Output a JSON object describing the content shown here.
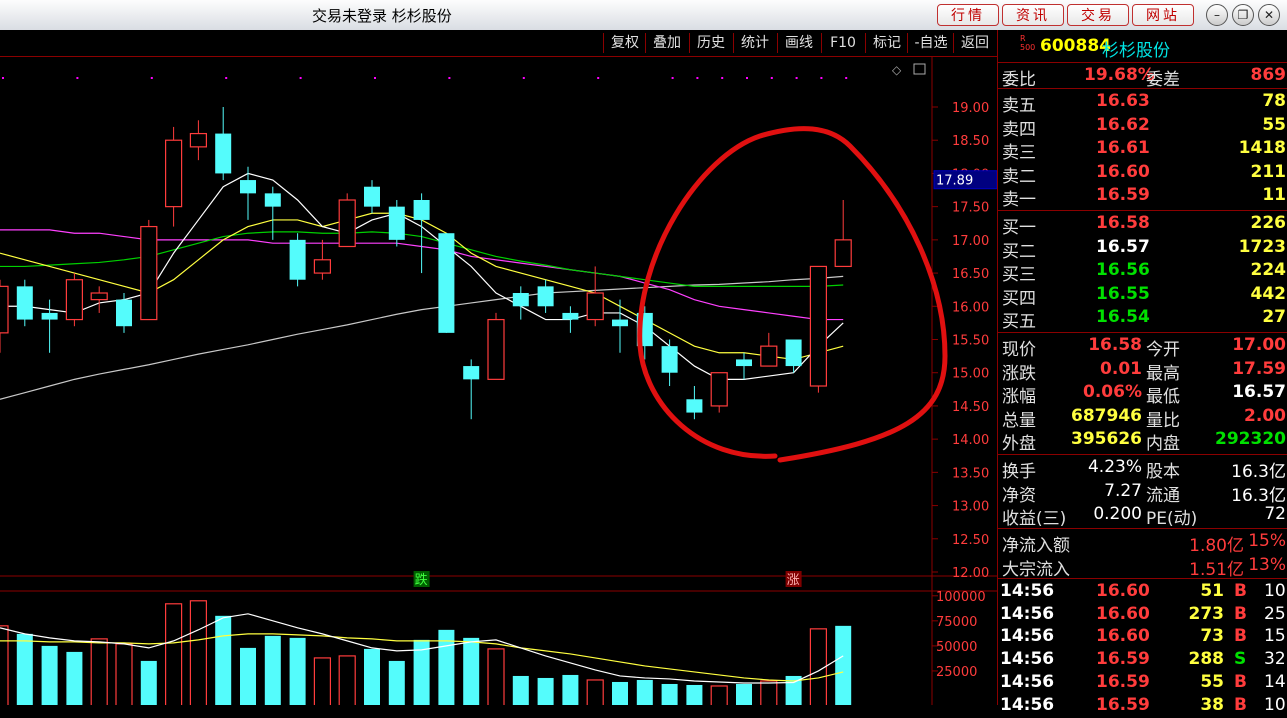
{
  "titlebar": {
    "title": "交易未登录  杉杉股份",
    "nav_buttons": [
      "行情",
      "资讯",
      "交易",
      "网站"
    ],
    "window_buttons": [
      "minimize",
      "restore",
      "close"
    ]
  },
  "toolbar": {
    "items": [
      "复权",
      "叠加",
      "历史",
      "统计",
      "画线",
      "F10",
      "标记",
      "-自选",
      "返回"
    ]
  },
  "chart_price": {
    "y_ticks": [
      "19.00",
      "18.50",
      "18.00",
      "17.50",
      "17.00",
      "16.50",
      "16.00",
      "15.50",
      "15.00",
      "14.50",
      "14.00",
      "13.50",
      "13.00",
      "12.50",
      "12.00"
    ],
    "ylim": [
      12.0,
      19.0
    ],
    "current_marker": "17.89",
    "markers": [
      {
        "text": "跌",
        "idx": 17
      },
      {
        "text": "涨",
        "idx": 32
      }
    ],
    "candles": [
      {
        "o": 15.6,
        "c": 16.3,
        "h": 16.4,
        "l": 15.3
      },
      {
        "o": 16.3,
        "c": 15.8,
        "h": 16.4,
        "l": 15.7
      },
      {
        "o": 15.9,
        "c": 15.8,
        "h": 16.1,
        "l": 15.3
      },
      {
        "o": 15.8,
        "c": 16.4,
        "h": 16.5,
        "l": 15.7
      },
      {
        "o": 16.1,
        "c": 16.2,
        "h": 16.3,
        "l": 15.9
      },
      {
        "o": 16.1,
        "c": 15.7,
        "h": 16.2,
        "l": 15.6
      },
      {
        "o": 15.8,
        "c": 17.2,
        "h": 17.3,
        "l": 15.8
      },
      {
        "o": 17.5,
        "c": 18.5,
        "h": 18.7,
        "l": 17.2
      },
      {
        "o": 18.4,
        "c": 18.6,
        "h": 18.8,
        "l": 18.2
      },
      {
        "o": 18.6,
        "c": 18.0,
        "h": 19.0,
        "l": 17.9
      },
      {
        "o": 17.9,
        "c": 17.7,
        "h": 18.1,
        "l": 17.3
      },
      {
        "o": 17.7,
        "c": 17.5,
        "h": 17.8,
        "l": 17.0
      },
      {
        "o": 17.0,
        "c": 16.4,
        "h": 17.1,
        "l": 16.3
      },
      {
        "o": 16.5,
        "c": 16.7,
        "h": 17.0,
        "l": 16.4
      },
      {
        "o": 16.9,
        "c": 17.6,
        "h": 17.7,
        "l": 16.9
      },
      {
        "o": 17.8,
        "c": 17.5,
        "h": 17.9,
        "l": 17.4
      },
      {
        "o": 17.5,
        "c": 17.0,
        "h": 17.6,
        "l": 16.9
      },
      {
        "o": 17.6,
        "c": 17.3,
        "h": 17.7,
        "l": 16.5
      },
      {
        "o": 17.1,
        "c": 15.6,
        "h": 17.1,
        "l": 15.6
      },
      {
        "o": 15.1,
        "c": 14.9,
        "h": 15.2,
        "l": 14.3
      },
      {
        "o": 14.9,
        "c": 15.8,
        "h": 15.9,
        "l": 14.9
      },
      {
        "o": 16.2,
        "c": 16.0,
        "h": 16.3,
        "l": 15.8
      },
      {
        "o": 16.3,
        "c": 16.0,
        "h": 16.4,
        "l": 15.9
      },
      {
        "o": 15.9,
        "c": 15.8,
        "h": 16.0,
        "l": 15.6
      },
      {
        "o": 15.8,
        "c": 16.2,
        "h": 16.6,
        "l": 15.7
      },
      {
        "o": 15.8,
        "c": 15.7,
        "h": 16.1,
        "l": 15.3
      },
      {
        "o": 15.9,
        "c": 15.4,
        "h": 16.0,
        "l": 15.2
      },
      {
        "o": 15.4,
        "c": 15.0,
        "h": 15.5,
        "l": 14.8
      },
      {
        "o": 14.6,
        "c": 14.4,
        "h": 14.8,
        "l": 14.3
      },
      {
        "o": 14.5,
        "c": 15.0,
        "h": 15.0,
        "l": 14.4
      },
      {
        "o": 15.2,
        "c": 15.1,
        "h": 15.3,
        "l": 14.9
      },
      {
        "o": 15.1,
        "c": 15.4,
        "h": 15.6,
        "l": 15.1
      },
      {
        "o": 15.5,
        "c": 15.1,
        "h": 15.5,
        "l": 15.0
      },
      {
        "o": 14.8,
        "c": 16.6,
        "h": 16.6,
        "l": 14.7
      },
      {
        "o": 16.6,
        "c": 17.0,
        "h": 17.6,
        "l": 16.6
      }
    ],
    "ma_white": [
      16.0,
      16.0,
      15.95,
      15.9,
      16.05,
      16.1,
      16.2,
      16.8,
      17.3,
      17.8,
      18.0,
      17.9,
      17.6,
      17.2,
      17.1,
      17.3,
      17.4,
      17.2,
      16.9,
      16.6,
      16.2,
      16.0,
      15.8,
      15.8,
      15.9,
      15.9,
      15.7,
      15.4,
      15.1,
      14.9,
      14.9,
      14.95,
      15.0,
      15.4,
      15.75
    ],
    "ma_yellow": [
      16.8,
      16.7,
      16.6,
      16.5,
      16.4,
      16.3,
      16.2,
      16.4,
      16.7,
      17.0,
      17.2,
      17.3,
      17.3,
      17.2,
      17.3,
      17.4,
      17.4,
      17.3,
      17.1,
      16.8,
      16.6,
      16.5,
      16.4,
      16.3,
      16.2,
      16.0,
      15.8,
      15.6,
      15.4,
      15.3,
      15.3,
      15.25,
      15.2,
      15.3,
      15.4
    ],
    "ma_green": [
      16.6,
      16.6,
      16.62,
      16.64,
      16.66,
      16.7,
      16.75,
      16.85,
      16.95,
      17.05,
      17.1,
      17.12,
      17.12,
      17.1,
      17.1,
      17.12,
      17.1,
      17.05,
      16.95,
      16.85,
      16.75,
      16.68,
      16.62,
      16.55,
      16.5,
      16.45,
      16.4,
      16.35,
      16.3,
      16.3,
      16.3,
      16.3,
      16.3,
      16.3,
      16.32
    ],
    "ma_magenta": [
      17.15,
      17.15,
      17.15,
      17.1,
      17.1,
      17.05,
      17.0,
      17.0,
      17.0,
      17.0,
      17.0,
      16.95,
      16.95,
      16.95,
      16.95,
      16.95,
      16.95,
      16.9,
      16.85,
      16.75,
      16.7,
      16.65,
      16.6,
      16.55,
      16.5,
      16.45,
      16.35,
      16.25,
      16.1,
      16.0,
      15.95,
      15.9,
      15.85,
      15.8,
      15.8
    ],
    "ma_gray": [
      14.6,
      14.7,
      14.8,
      14.9,
      14.98,
      15.05,
      15.12,
      15.2,
      15.28,
      15.35,
      15.42,
      15.5,
      15.58,
      15.65,
      15.72,
      15.8,
      15.88,
      15.95,
      16.0,
      16.05,
      16.1,
      16.15,
      16.2,
      16.22,
      16.24,
      16.26,
      16.28,
      16.3,
      16.32,
      16.33,
      16.35,
      16.37,
      16.4,
      16.42,
      16.45
    ]
  },
  "chart_volume": {
    "y_ticks": [
      "100000",
      "75000",
      "50000",
      "25000"
    ],
    "ylim": [
      0,
      110000
    ],
    "bars": [
      {
        "v": 70000,
        "up": true
      },
      {
        "v": 62000,
        "up": false
      },
      {
        "v": 50000,
        "up": false
      },
      {
        "v": 44000,
        "up": false
      },
      {
        "v": 57000,
        "up": true
      },
      {
        "v": 52000,
        "up": true
      },
      {
        "v": 35000,
        "up": false
      },
      {
        "v": 92000,
        "up": true
      },
      {
        "v": 95000,
        "up": true
      },
      {
        "v": 80000,
        "up": false
      },
      {
        "v": 48000,
        "up": false
      },
      {
        "v": 60000,
        "up": false
      },
      {
        "v": 58000,
        "up": false
      },
      {
        "v": 38000,
        "up": true
      },
      {
        "v": 40000,
        "up": true
      },
      {
        "v": 47000,
        "up": false
      },
      {
        "v": 35000,
        "up": false
      },
      {
        "v": 56000,
        "up": false
      },
      {
        "v": 66000,
        "up": false
      },
      {
        "v": 58000,
        "up": false
      },
      {
        "v": 47000,
        "up": true
      },
      {
        "v": 20000,
        "up": false
      },
      {
        "v": 18000,
        "up": false
      },
      {
        "v": 21000,
        "up": false
      },
      {
        "v": 16000,
        "up": true
      },
      {
        "v": 14000,
        "up": false
      },
      {
        "v": 16000,
        "up": false
      },
      {
        "v": 12000,
        "up": false
      },
      {
        "v": 11000,
        "up": false
      },
      {
        "v": 10000,
        "up": true
      },
      {
        "v": 12000,
        "up": false
      },
      {
        "v": 15000,
        "up": true
      },
      {
        "v": 20000,
        "up": false
      },
      {
        "v": 67000,
        "up": true
      },
      {
        "v": 70000,
        "up": false
      }
    ],
    "ma_white": [
      68000,
      62000,
      58000,
      55000,
      54000,
      52000,
      48000,
      55000,
      66000,
      78000,
      82000,
      75000,
      68000,
      62000,
      55000,
      48000,
      45000,
      46000,
      50000,
      54000,
      56000,
      48000,
      40000,
      33000,
      26000,
      20000,
      18000,
      17000,
      15000,
      14000,
      13000,
      13000,
      13500,
      25000,
      40000
    ],
    "ma_yellow": [
      55000,
      55000,
      54000,
      54000,
      53000,
      53000,
      52000,
      53000,
      56000,
      60000,
      62000,
      62000,
      61000,
      60000,
      58000,
      57000,
      55000,
      55000,
      55000,
      54000,
      52000,
      48000,
      45000,
      42000,
      38000,
      34000,
      30000,
      27000,
      24000,
      21000,
      18000,
      16000,
      15000,
      18000,
      24000
    ]
  },
  "quote": {
    "code": "600884",
    "name": "杉杉股份",
    "r_badge": "R\n500",
    "weibi": {
      "label": "委比",
      "value": "19.68%",
      "label2": "委差",
      "value2": "869"
    },
    "asks": [
      {
        "label": "卖五",
        "price": "16.63",
        "vol": "78"
      },
      {
        "label": "卖四",
        "price": "16.62",
        "vol": "55"
      },
      {
        "label": "卖三",
        "price": "16.61",
        "vol": "1418"
      },
      {
        "label": "卖二",
        "price": "16.60",
        "vol": "211"
      },
      {
        "label": "卖一",
        "price": "16.59",
        "vol": "11"
      }
    ],
    "bids": [
      {
        "label": "买一",
        "price": "16.58",
        "vol": "226"
      },
      {
        "label": "买二",
        "price": "16.57",
        "vol": "1723"
      },
      {
        "label": "买三",
        "price": "16.56",
        "vol": "224"
      },
      {
        "label": "买四",
        "price": "16.55",
        "vol": "442"
      },
      {
        "label": "买五",
        "price": "16.54",
        "vol": "27"
      }
    ],
    "stats1": [
      {
        "l1": "现价",
        "v1": "16.58",
        "l2": "今开",
        "v2": "17.00"
      },
      {
        "l1": "涨跌",
        "v1": "0.01",
        "l2": "最高",
        "v2": "17.59"
      },
      {
        "l1": "涨幅",
        "v1": "0.06%",
        "l2": "最低",
        "v2": "16.57"
      },
      {
        "l1": "总量",
        "v1": "687946",
        "l2": "量比",
        "v2": "2.00"
      },
      {
        "l1": "外盘",
        "v1": "395626",
        "l2": "内盘",
        "v2": "292320"
      }
    ],
    "stats2": [
      {
        "l1": "换手",
        "v1": "4.23%",
        "l2": "股本",
        "v2": "16.3亿"
      },
      {
        "l1": "净资",
        "v1": "7.27",
        "l2": "流通",
        "v2": "16.3亿"
      },
      {
        "l1": "收益(三)",
        "v1": "0.200",
        "l2": "PE(动)",
        "v2": "72"
      }
    ],
    "flows": [
      {
        "label": "净流入额",
        "value": "1.80亿",
        "pct": "15%"
      },
      {
        "label": "大宗流入",
        "value": "1.51亿",
        "pct": "13%"
      }
    ],
    "ticks": [
      {
        "time": "14:56",
        "price": "16.60",
        "vol": "51",
        "side": "B",
        "n": "10"
      },
      {
        "time": "14:56",
        "price": "16.60",
        "vol": "273",
        "side": "B",
        "n": "25"
      },
      {
        "time": "14:56",
        "price": "16.60",
        "vol": "73",
        "side": "B",
        "n": "15"
      },
      {
        "time": "14:56",
        "price": "16.59",
        "vol": "288",
        "side": "S",
        "n": "32"
      },
      {
        "time": "14:56",
        "price": "16.59",
        "vol": "55",
        "side": "B",
        "n": "14"
      },
      {
        "time": "14:56",
        "price": "16.59",
        "vol": "38",
        "side": "B",
        "n": "10"
      }
    ]
  },
  "colors": {
    "up": "#ff3c3c",
    "down": "#54fcfc",
    "bg": "#000000",
    "grid": "#8b0000",
    "annotation": "#e01010"
  }
}
